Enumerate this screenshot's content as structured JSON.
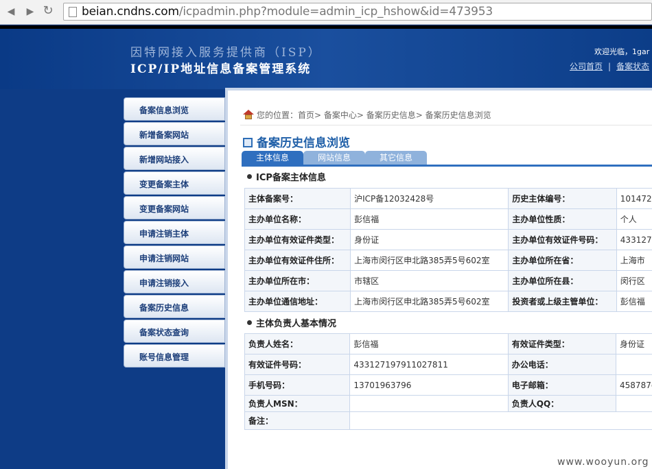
{
  "browser": {
    "url_domain": "beian.cndns.com",
    "url_path": "/icpadmin.php?module=admin_icp_hshow&id=473953",
    "back_glyph": "◀",
    "forward_glyph": "▶",
    "reload_glyph": "↻"
  },
  "header": {
    "subtitle": "因特网接入服务提供商（ISP）",
    "title": "ICP/IP地址信息备案管理系统",
    "welcome": "欢迎光临，1gar",
    "links": [
      "公司首页",
      "备案状态"
    ],
    "link_separator": "|"
  },
  "sidebar": {
    "items": [
      {
        "label": "备案信息浏览"
      },
      {
        "label": "新增备案网站"
      },
      {
        "label": "新增网站接入"
      },
      {
        "label": "变更备案主体"
      },
      {
        "label": "变更备案网站"
      },
      {
        "label": "申请注销主体"
      },
      {
        "label": "申请注销网站"
      },
      {
        "label": "申请注销接入"
      },
      {
        "label": "备案历史信息"
      },
      {
        "label": "备案状态查询"
      },
      {
        "label": "账号信息管理"
      }
    ]
  },
  "breadcrumb": {
    "prefix": "您的位置：",
    "trail": "首页> 备案中心> 备案历史信息> 备案历史信息浏览"
  },
  "page_title": "备案历史信息浏览",
  "tabs": [
    {
      "label": "主体信息",
      "active": true
    },
    {
      "label": "网站信息",
      "active": false
    },
    {
      "label": "其它信息",
      "active": false
    }
  ],
  "section1": {
    "title": "ICP备案主体信息",
    "rows": [
      [
        "主体备案号：",
        "沪ICP备12032428号",
        "历史主体编号：",
        "101472"
      ],
      [
        "主办单位名称：",
        "彭信福",
        "主办单位性质：",
        "个人"
      ],
      [
        "主办单位有效证件类型：",
        "身份证",
        "主办单位有效证件号码：",
        "4331271"
      ],
      [
        "主办单位有效证件住所：",
        "上海市闵行区申北路385弄5号602室",
        "主办单位所在省：",
        "上海市"
      ],
      [
        "主办单位所在市：",
        "市辖区",
        "主办单位所在县：",
        "闵行区"
      ],
      [
        "主办单位通信地址：",
        "上海市闵行区申北路385弄5号602室",
        "投资者或上级主管单位：",
        "彭信福"
      ]
    ]
  },
  "section2": {
    "title": "主体负责人基本情况",
    "rows": [
      [
        "负责人姓名：",
        "彭信福",
        "有效证件类型：",
        "身份证"
      ],
      [
        "有效证件号码：",
        "433127197911027811",
        "办公电话：",
        ""
      ],
      [
        "手机号码：",
        "13701963796",
        "电子邮箱：",
        "458787@"
      ],
      [
        "负责人MSN：",
        "",
        "负责人QQ：",
        ""
      ]
    ],
    "remark_label": "备注：",
    "remark_value": ""
  },
  "watermark": "www.wooyun.org",
  "colors": {
    "background": "#0e3c86",
    "accent": "#2f6fbf",
    "table_border": "#c9d6ea"
  }
}
